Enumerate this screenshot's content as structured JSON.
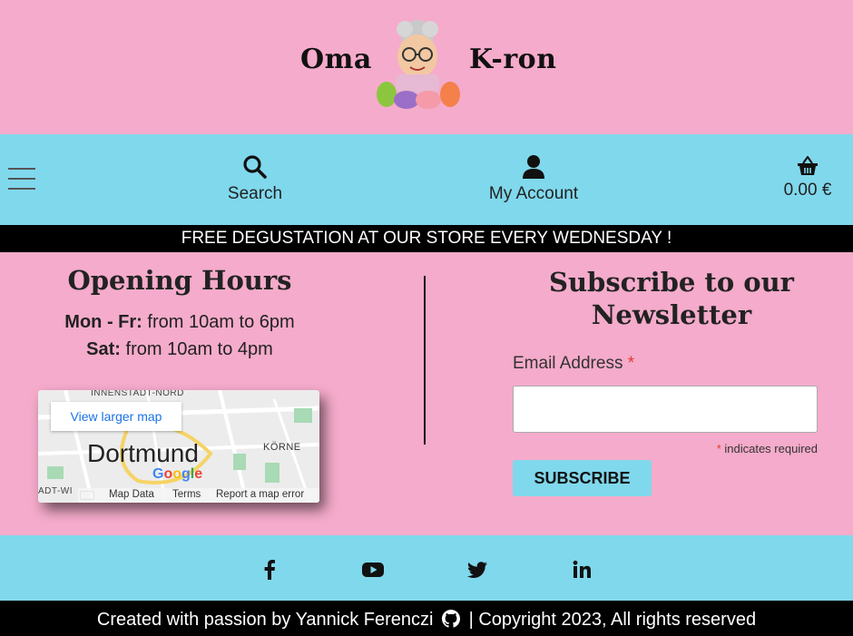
{
  "header": {
    "logo_left": "Oma",
    "logo_right": "K-ron"
  },
  "nav": {
    "search_label": "Search",
    "account_label": "My Account",
    "cart_total": "0.00 €"
  },
  "banner": {
    "text": "FREE DEGUSTATION AT OUR STORE EVERY WEDNESDAY !"
  },
  "hours": {
    "title": "Opening Hours",
    "lines": [
      {
        "day": "Mon - Fr:",
        "time": "from 10am to 6pm"
      },
      {
        "day": "Sat:",
        "time": "from 10am to 4pm"
      }
    ]
  },
  "map": {
    "view_larger": "View larger map",
    "city": "Dortmund",
    "district": "KÖRNE",
    "district_top": "INNENSTADT-NORD",
    "district_left": "ADT-WI",
    "google": "Google",
    "map_data": "Map Data",
    "terms": "Terms",
    "report": "Report a map error"
  },
  "newsletter": {
    "title": "Subscribe to our Newsletter",
    "email_label": "Email Address",
    "required_star": "*",
    "required_note": "indicates required",
    "email_value": "",
    "subscribe_label": "SUBSCRIBE"
  },
  "social": {
    "icons": [
      "facebook-icon",
      "youtube-icon",
      "twitter-icon",
      "linkedin-icon"
    ]
  },
  "footer": {
    "text_before": "Created with passion by Yannick Ferenczi",
    "text_after": "| Copyright 2023, All rights reserved"
  },
  "colors": {
    "pink": "#f5abcb",
    "cyan": "#80d8ec",
    "black": "#000000"
  }
}
